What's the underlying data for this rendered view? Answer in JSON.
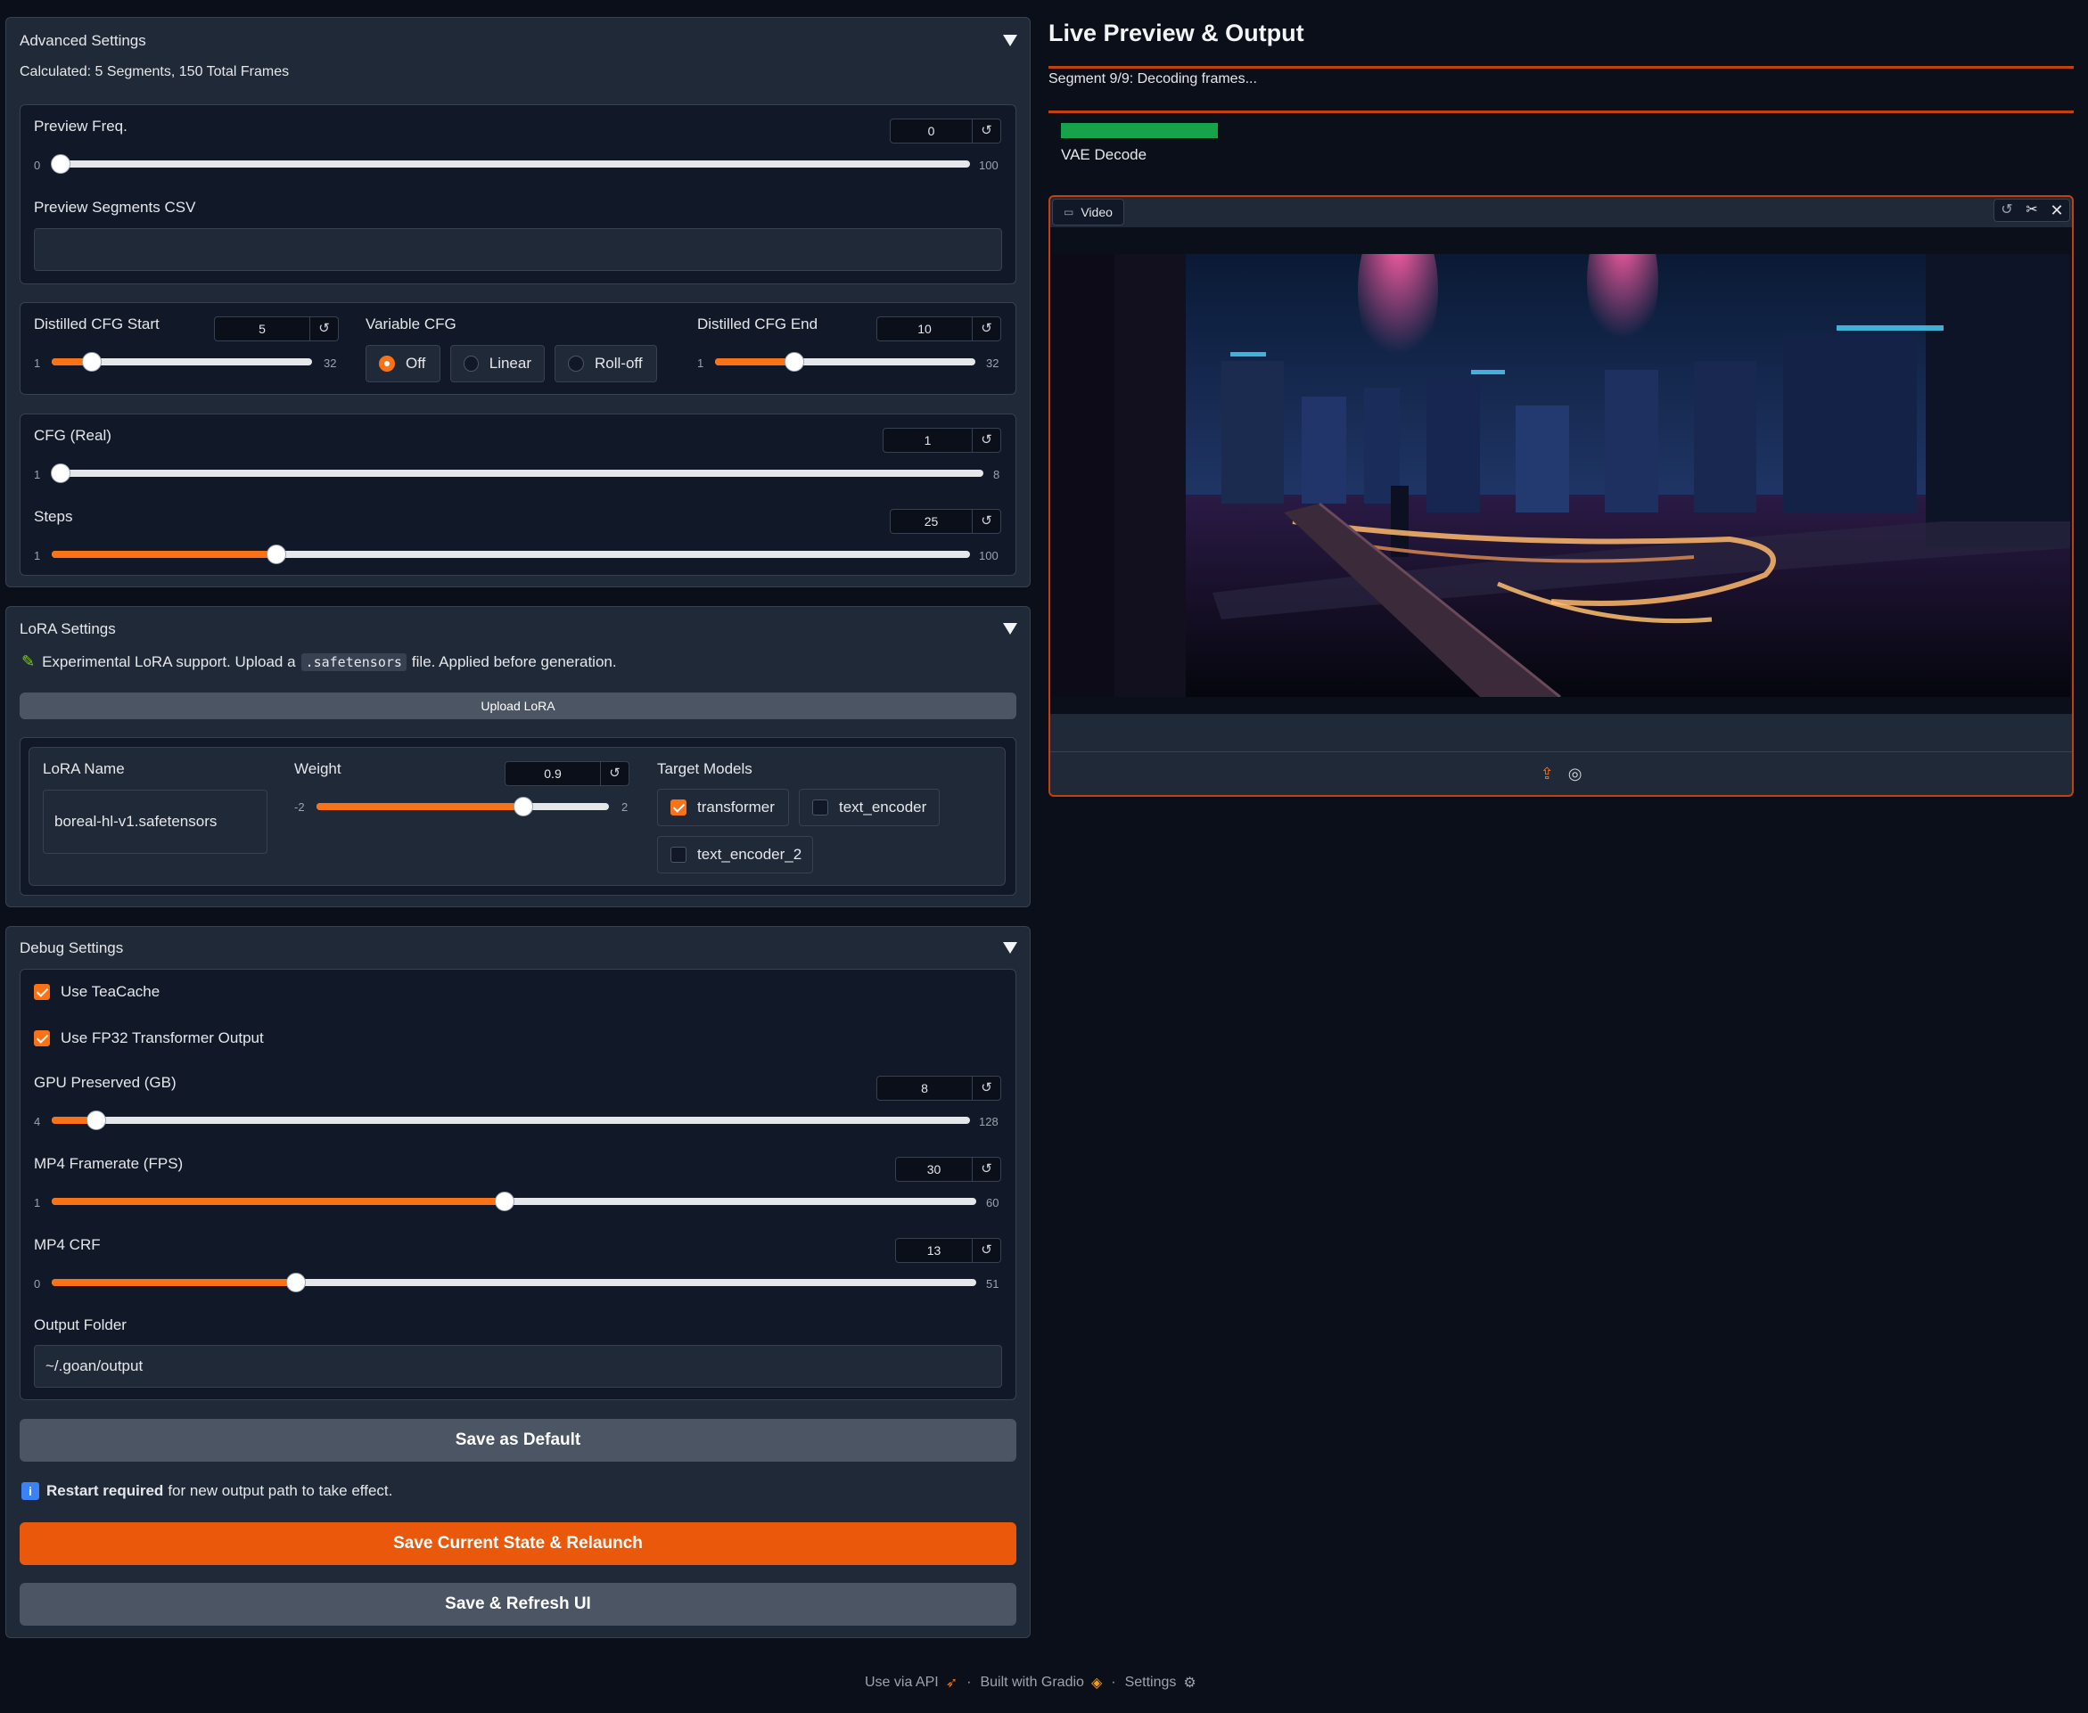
{
  "advanced": {
    "title": "Advanced Settings",
    "calculated": "Calculated: 5 Segments, 150 Total Frames",
    "preview_freq": {
      "label": "Preview Freq.",
      "value": "0",
      "min": "0",
      "max": "100",
      "fraction": 0.0
    },
    "preview_segments": {
      "label": "Preview Segments CSV",
      "value": ""
    },
    "cfg_start": {
      "label": "Distilled CFG Start",
      "value": "5",
      "min": "1",
      "max": "32",
      "fraction": 0.13
    },
    "variable_cfg": {
      "label": "Variable CFG",
      "options": [
        "Off",
        "Linear",
        "Roll-off"
      ],
      "selected": "Off"
    },
    "cfg_end": {
      "label": "Distilled CFG End",
      "value": "10",
      "min": "1",
      "max": "32",
      "fraction": 0.29
    },
    "cfg_real": {
      "label": "CFG (Real)",
      "value": "1",
      "min": "1",
      "max": "8",
      "fraction": 0.0
    },
    "steps": {
      "label": "Steps",
      "value": "25",
      "min": "1",
      "max": "100",
      "fraction": 0.24
    }
  },
  "lora": {
    "title": "LoRA Settings",
    "note_pre": "Experimental LoRA support. Upload a",
    "note_code": ".safetensors",
    "note_post": "file. Applied before generation.",
    "upload_label": "Upload LoRA",
    "name_label": "LoRA Name",
    "name_value": "boreal-hl-v1.safetensors",
    "weight": {
      "label": "Weight",
      "value": "0.9",
      "min": "-2",
      "max": "2",
      "fraction": 0.72
    },
    "target_label": "Target Models",
    "targets": [
      {
        "label": "transformer",
        "checked": true
      },
      {
        "label": "text_encoder",
        "checked": false
      },
      {
        "label": "text_encoder_2",
        "checked": false
      }
    ]
  },
  "debug": {
    "title": "Debug Settings",
    "teacache": {
      "label": "Use TeaCache",
      "checked": true
    },
    "fp32": {
      "label": "Use FP32 Transformer Output",
      "checked": true
    },
    "gpu": {
      "label": "GPU Preserved (GB)",
      "value": "8",
      "min": "4",
      "max": "128",
      "fraction": 0.04
    },
    "fps": {
      "label": "MP4 Framerate (FPS)",
      "value": "30",
      "min": "1",
      "max": "60",
      "fraction": 0.49
    },
    "crf": {
      "label": "MP4 CRF",
      "value": "13",
      "min": "0",
      "max": "51",
      "fraction": 0.26
    },
    "output_label": "Output Folder",
    "output_value": "~/.goan/output",
    "save_default": "Save as Default",
    "restart_bold": "Restart required",
    "restart_rest": "for new output path to take effect.",
    "save_relaunch": "Save Current State & Relaunch",
    "save_refresh": "Save & Refresh UI"
  },
  "preview": {
    "title": "Live Preview & Output",
    "status": "Segment 9/9: Decoding frames...",
    "progress_label": "VAE Decode",
    "progress_fraction": 0.18,
    "video_label": "Video"
  },
  "footer": {
    "api": "Use via API",
    "built": "Built with Gradio",
    "settings": "Settings"
  },
  "colors": {
    "accent": "#f97316",
    "progress": "#16a34a",
    "background": "#0b0f19"
  }
}
